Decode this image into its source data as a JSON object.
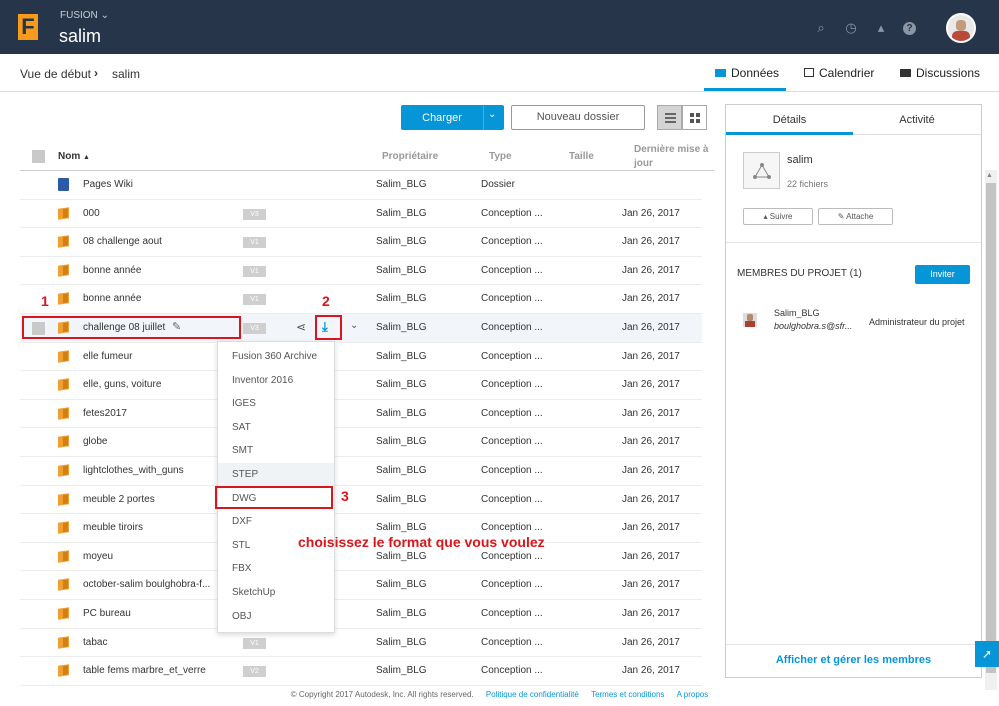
{
  "app": {
    "name": "FUSION",
    "project_title": "salim"
  },
  "breadcrumb": {
    "home": "Vue de début",
    "current": "salim"
  },
  "nav_tabs": [
    "Données",
    "Calendrier",
    "Discussions"
  ],
  "toolbar": {
    "upload_label": "Charger",
    "new_folder_label": "Nouveau dossier"
  },
  "table": {
    "columns": {
      "name": "Nom",
      "owner": "Propriétaire",
      "type": "Type",
      "size": "Taille",
      "modified": "Dernière mise à jour"
    },
    "rows": [
      {
        "name": "Pages Wiki",
        "version": "",
        "owner": "Salim_BLG",
        "type": "Dossier",
        "date": ""
      },
      {
        "name": "000",
        "version": "V3",
        "owner": "Salim_BLG",
        "type": "Conception ...",
        "date": "Jan 26, 2017"
      },
      {
        "name": "08 challenge aout",
        "version": "V1",
        "owner": "Salim_BLG",
        "type": "Conception ...",
        "date": "Jan 26, 2017"
      },
      {
        "name": "bonne année",
        "version": "V1",
        "owner": "Salim_BLG",
        "type": "Conception ...",
        "date": "Jan 26, 2017"
      },
      {
        "name": "bonne année",
        "version": "V1",
        "owner": "Salim_BLG",
        "type": "Conception ...",
        "date": "Jan 26, 2017"
      },
      {
        "name": "challenge 08 juillet",
        "version": "V3",
        "owner": "Salim_BLG",
        "type": "Conception ...",
        "date": "Jan 26, 2017"
      },
      {
        "name": "elle fumeur",
        "version": "",
        "owner": "Salim_BLG",
        "type": "Conception ...",
        "date": "Jan 26, 2017"
      },
      {
        "name": "elle, guns, voiture",
        "version": "",
        "owner": "Salim_BLG",
        "type": "Conception ...",
        "date": "Jan 26, 2017"
      },
      {
        "name": "fetes2017",
        "version": "",
        "owner": "Salim_BLG",
        "type": "Conception ...",
        "date": "Jan 26, 2017"
      },
      {
        "name": "globe",
        "version": "",
        "owner": "Salim_BLG",
        "type": "Conception ...",
        "date": "Jan 26, 2017"
      },
      {
        "name": "lightclothes_with_guns",
        "version": "",
        "owner": "Salim_BLG",
        "type": "Conception ...",
        "date": "Jan 26, 2017"
      },
      {
        "name": "meuble 2 portes",
        "version": "",
        "owner": "Salim_BLG",
        "type": "Conception ...",
        "date": "Jan 26, 2017"
      },
      {
        "name": "meuble tiroirs",
        "version": "",
        "owner": "Salim_BLG",
        "type": "Conception ...",
        "date": "Jan 26, 2017"
      },
      {
        "name": "moyeu",
        "version": "",
        "owner": "Salim_BLG",
        "type": "Conception ...",
        "date": "Jan 26, 2017"
      },
      {
        "name": "october-salim boulghobra-f...",
        "version": "",
        "owner": "Salim_BLG",
        "type": "Conception ...",
        "date": "Jan 26, 2017"
      },
      {
        "name": "PC bureau",
        "version": "",
        "owner": "Salim_BLG",
        "type": "Conception ...",
        "date": "Jan 26, 2017"
      },
      {
        "name": "tabac",
        "version": "V1",
        "owner": "Salim_BLG",
        "type": "Conception ...",
        "date": "Jan 26, 2017"
      },
      {
        "name": "table fems marbre_et_verre",
        "version": "V2",
        "owner": "Salim_BLG",
        "type": "Conception ...",
        "date": "Jan 26, 2017"
      }
    ]
  },
  "download_menu": [
    "Fusion 360 Archive",
    "Inventor 2016",
    "IGES",
    "SAT",
    "SMT",
    "STEP",
    "DWG",
    "DXF",
    "STL",
    "FBX",
    "SketchUp",
    "OBJ"
  ],
  "annotations": {
    "step1": "1",
    "step2": "2",
    "step3": "3",
    "note": "choisissez le format que vous voulez"
  },
  "panel": {
    "tabs": [
      "Détails",
      "Activité"
    ],
    "project_name": "salim",
    "file_count": "22 fichiers",
    "follow_label": "Suivre",
    "attach_label": "Attache",
    "members_title": "MEMBRES DU PROJET (1)",
    "invite_label": "Inviter",
    "member": {
      "name": "Salim_BLG",
      "email": "boulghobra.s@sfr...",
      "role": "Administrateur du projet"
    },
    "manage_link": "Afficher et gérer les membres"
  },
  "footer": {
    "copyright": "© Copyright 2017 Autodesk, Inc. All rights reserved.",
    "links": [
      "Politique de confidentialité",
      "Termes et conditions",
      "A propos"
    ]
  },
  "colors": {
    "topbar": "#27354a",
    "accent": "#0696d7",
    "annotation": "#d8161c",
    "logo": "#f89a1c"
  }
}
